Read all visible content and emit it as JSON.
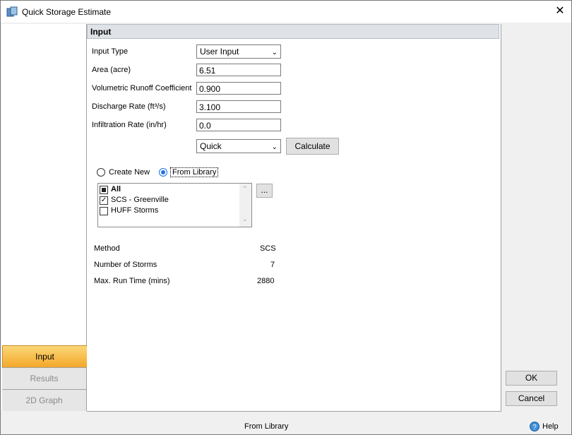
{
  "window": {
    "title": "Quick Storage Estimate",
    "close": "✕"
  },
  "nav": {
    "input": "Input",
    "results": "Results",
    "graph": "2D Graph"
  },
  "section": {
    "header": "Input"
  },
  "fields": {
    "input_type_label": "Input Type",
    "input_type_value": "User Input",
    "area_label": "Area (acre)",
    "area_value": "6.51",
    "coef_label": "Volumetric Runoff Coefficient",
    "coef_value": "0.900",
    "discharge_label": "Discharge Rate (ft³/s)",
    "discharge_value": "3.100",
    "infil_label": "Infiltration Rate (in/hr)",
    "infil_value": "0.0",
    "method_dropdown": "Quick",
    "calculate": "Calculate"
  },
  "radios": {
    "create_new": "Create New",
    "from_library": "From Library",
    "selected": "from_library"
  },
  "library": {
    "items": [
      {
        "label": "All",
        "state": "partial"
      },
      {
        "label": "SCS - Greenville",
        "state": "checked"
      },
      {
        "label": "HUFF Storms",
        "state": "unchecked"
      }
    ],
    "browse": "..."
  },
  "summary": {
    "method_label": "Method",
    "method_value": "SCS",
    "storms_label": "Number of Storms",
    "storms_value": "7",
    "runtime_label": "Max. Run Time (mins)",
    "runtime_value": "2880"
  },
  "buttons": {
    "ok": "OK",
    "cancel": "Cancel"
  },
  "status": {
    "text": "From Library",
    "help": "Help"
  },
  "icons": {
    "app": "storage-app-icon",
    "help": "help-icon"
  }
}
